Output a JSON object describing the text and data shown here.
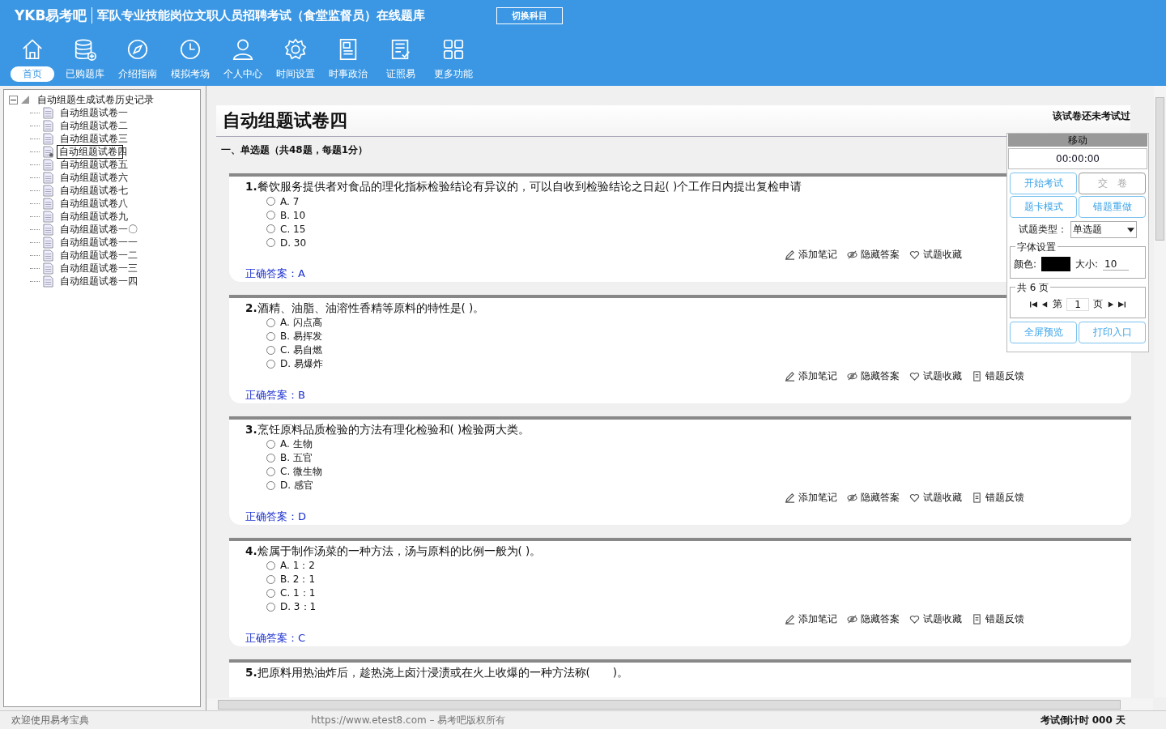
{
  "header": {
    "logo": "YKB易考吧",
    "title": "军队专业技能岗位文职人员招聘考试（食堂监督员）在线题库",
    "switch_button": "切换科目"
  },
  "toolbar": [
    {
      "kind": "home",
      "label": "首页",
      "selected": true
    },
    {
      "kind": "database",
      "label": "已购题库",
      "selected": false
    },
    {
      "kind": "compass",
      "label": "介绍指南",
      "selected": false
    },
    {
      "kind": "clock",
      "label": "模拟考场",
      "selected": false
    },
    {
      "kind": "person",
      "label": "个人中心",
      "selected": false
    },
    {
      "kind": "gear",
      "label": "时间设置",
      "selected": false
    },
    {
      "kind": "news",
      "label": "时事政治",
      "selected": false
    },
    {
      "kind": "list",
      "label": "证照易",
      "selected": false
    },
    {
      "kind": "grid",
      "label": "更多功能",
      "selected": false
    }
  ],
  "tree": {
    "label": "自动组题生成试卷历史记录",
    "expanded": true,
    "children": [
      {
        "label": "自动组题试卷一",
        "selected": false
      },
      {
        "label": "自动组题试卷二",
        "selected": false
      },
      {
        "label": "自动组题试卷三",
        "selected": false
      },
      {
        "label": "自动组题试卷四",
        "selected": true
      },
      {
        "label": "自动组题试卷五",
        "selected": false
      },
      {
        "label": "自动组题试卷六",
        "selected": false
      },
      {
        "label": "自动组题试卷七",
        "selected": false
      },
      {
        "label": "自动组题试卷八",
        "selected": false
      },
      {
        "label": "自动组题试卷九",
        "selected": false
      },
      {
        "label": "自动组题试卷一〇",
        "selected": false
      },
      {
        "label": "自动组题试卷一一",
        "selected": false
      },
      {
        "label": "自动组题试卷一二",
        "selected": false
      },
      {
        "label": "自动组题试卷一三",
        "selected": false
      },
      {
        "label": "自动组题试卷一四",
        "selected": false
      }
    ]
  },
  "paper": {
    "title": "自动组题试卷四",
    "status": "该试卷还未考试过",
    "section": "一、单选题（共48题，每题1分）"
  },
  "questions": [
    {
      "number": "1.",
      "text": "餐饮服务提供者对食品的理化指标检验结论有异议的，可以自收到检验结论之日起( )个工作日内提出复检申请",
      "options": [
        {
          "label": "A. 7",
          "checked": false
        },
        {
          "label": "B. 10",
          "checked": false
        },
        {
          "label": "C. 15",
          "checked": false
        },
        {
          "label": "D. 30",
          "checked": false
        }
      ],
      "actions": [
        {
          "kind": "note",
          "label": "添加笔记"
        },
        {
          "kind": "hide",
          "label": "隐藏答案"
        },
        {
          "kind": "fav",
          "label": "试题收藏"
        }
      ],
      "answer_label": "正确答案：",
      "answer": "A"
    },
    {
      "number": "2.",
      "text": "酒精、油脂、油溶性香精等原料的特性是( )。",
      "options": [
        {
          "label": "A. 闪点高",
          "checked": false
        },
        {
          "label": "B. 易挥发",
          "checked": false
        },
        {
          "label": "C. 易自燃",
          "checked": false
        },
        {
          "label": "D. 易爆炸",
          "checked": false
        }
      ],
      "actions": [
        {
          "kind": "note",
          "label": "添加笔记"
        },
        {
          "kind": "hide",
          "label": "隐藏答案"
        },
        {
          "kind": "fav",
          "label": "试题收藏"
        },
        {
          "kind": "report",
          "label": "错题反馈"
        }
      ],
      "answer_label": "正确答案：",
      "answer": "B"
    },
    {
      "number": "3.",
      "text": "烹饪原料品质检验的方法有理化检验和( )检验两大类。",
      "options": [
        {
          "label": "A. 生物",
          "checked": false
        },
        {
          "label": "B. 五官",
          "checked": false
        },
        {
          "label": "C. 微生物",
          "checked": false
        },
        {
          "label": "D. 感官",
          "checked": false
        }
      ],
      "actions": [
        {
          "kind": "note",
          "label": "添加笔记"
        },
        {
          "kind": "hide",
          "label": "隐藏答案"
        },
        {
          "kind": "fav",
          "label": "试题收藏"
        },
        {
          "kind": "report",
          "label": "错题反馈"
        }
      ],
      "answer_label": "正确答案：",
      "answer": "D"
    },
    {
      "number": "4.",
      "text": "烩属于制作汤菜的一种方法，汤与原料的比例一般为( )。",
      "options": [
        {
          "label": "A. 1：2",
          "checked": false
        },
        {
          "label": "B. 2：1",
          "checked": false
        },
        {
          "label": "C. 1：1",
          "checked": false
        },
        {
          "label": "D. 3：1",
          "checked": false
        }
      ],
      "actions": [
        {
          "kind": "note",
          "label": "添加笔记"
        },
        {
          "kind": "hide",
          "label": "隐藏答案"
        },
        {
          "kind": "fav",
          "label": "试题收藏"
        },
        {
          "kind": "report",
          "label": "错题反馈"
        }
      ],
      "answer_label": "正确答案：",
      "answer": "C"
    },
    {
      "number": "5.",
      "text": "把原料用热油炸后，趁热浇上卤汁浸渍或在火上收爆的一种方法称(　　)。"
    }
  ],
  "panel": {
    "move_label": "移动",
    "timer": "00:00:00",
    "buttons": [
      {
        "label": "开始考试",
        "disabled": false
      },
      {
        "label": "交　卷",
        "disabled": true
      },
      {
        "label": "题卡模式",
        "disabled": false
      },
      {
        "label": "错题重做",
        "disabled": false
      }
    ],
    "type_label": "试题类型：",
    "type_value": "单选题",
    "font_legend": "字体设置",
    "color_label": "颜色:",
    "size_label": "大小:",
    "size_value": "10",
    "pages_legend": "共 6 页",
    "page_prefix": "第",
    "page_value": "1",
    "page_suffix": "页",
    "bottom_buttons": [
      "全屏预览",
      "打印入口"
    ]
  },
  "status_bar": {
    "welcome": "欢迎使用易考宝典",
    "copyright": "https://www.etest8.com – 易考吧版权所有",
    "countdown": "考试倒计时 000 天"
  }
}
